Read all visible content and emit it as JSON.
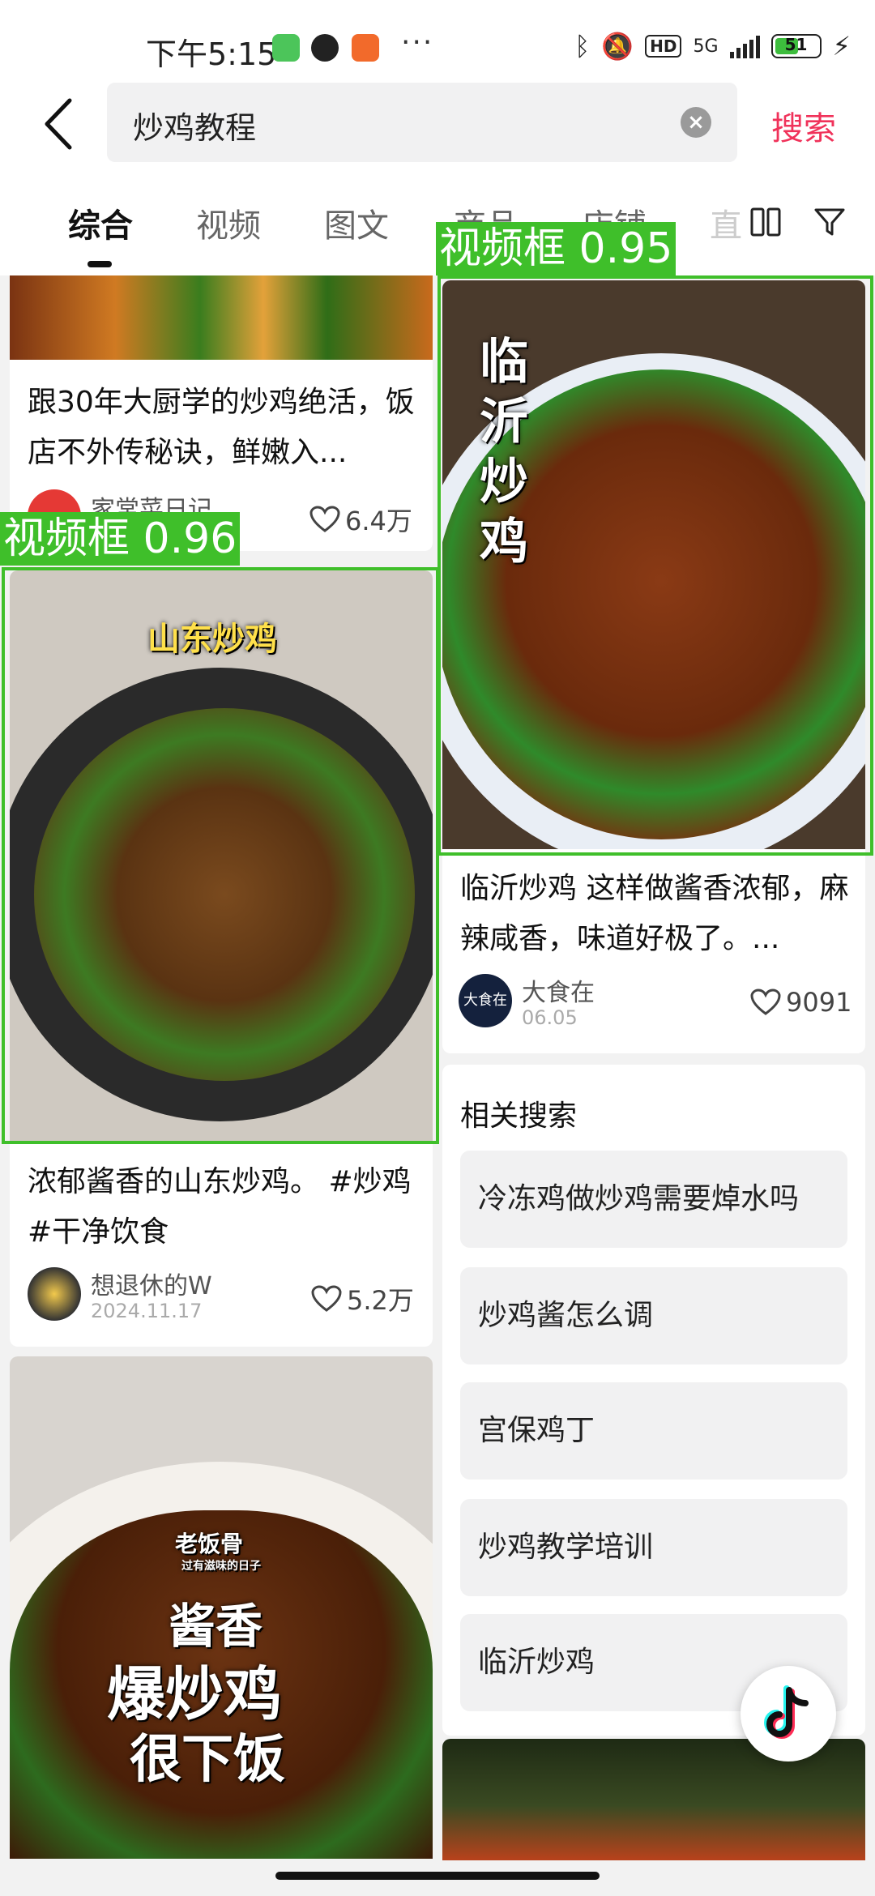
{
  "status_bar": {
    "time": "下午5:15",
    "dots": "···",
    "network": "5G",
    "hd": "HD",
    "battery": "51"
  },
  "search": {
    "query": "炒鸡教程",
    "clear_icon": "clear-icon",
    "button": "搜索"
  },
  "tabs": [
    {
      "label": "综合",
      "active": true
    },
    {
      "label": "视频"
    },
    {
      "label": "图文"
    },
    {
      "label": "商品"
    },
    {
      "label": "店铺"
    },
    {
      "label": "直"
    }
  ],
  "cards": {
    "top_partial": {
      "title": "跟30年大厨学的炒鸡绝活，饭店不外传秘诀，鲜嫩入...",
      "author": "家常菜日记",
      "likes": "6.4万"
    },
    "shandong": {
      "overlay": "山东炒鸡",
      "title": "浓郁酱香的山东炒鸡。 #炒鸡 #干净饮食",
      "author": "想退休的W",
      "date": "2024.11.17",
      "likes": "5.2万"
    },
    "linyi": {
      "overlay": "临沂炒鸡",
      "title": "临沂炒鸡 这样做酱香浓郁，麻辣咸香，味道好极了。...",
      "author": "大食在",
      "avatar_text": "大食在",
      "date": "06.05",
      "likes": "9091"
    },
    "sauce": {
      "overlay_brand": "老饭骨",
      "overlay_sub": "过有滋味的日子",
      "overlay_line1": "酱香",
      "overlay_line2": "爆炒鸡",
      "overlay_line3": "很下饭"
    }
  },
  "detections": [
    {
      "label": "视频框 0.96"
    },
    {
      "label": "视频框 0.95"
    }
  ],
  "related": {
    "title": "相关搜索",
    "items": [
      "冷冻鸡做炒鸡需要焯水吗",
      "炒鸡酱怎么调",
      "宫保鸡丁",
      "炒鸡教学培训",
      "临沂炒鸡"
    ]
  },
  "colors": {
    "accent": "#f0325a",
    "detection": "#3fbf2a"
  }
}
